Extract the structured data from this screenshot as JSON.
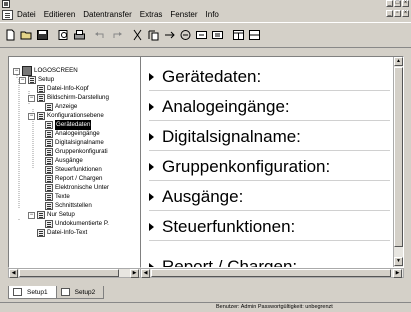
{
  "menu": {
    "items": [
      "Datei",
      "Editieren",
      "Datentransfer",
      "Extras",
      "Fenster",
      "Info"
    ]
  },
  "tree": {
    "root": "LOGOSCREEN",
    "items": [
      {
        "label": "Setup"
      },
      {
        "label": "Datei-Info-Kopf"
      },
      {
        "label": "Bildschirm-Darstellung"
      },
      {
        "label": "Anzeige"
      },
      {
        "label": "Konfigurationsebene"
      },
      {
        "label": "Gerätedaten"
      },
      {
        "label": "Analogeingänge"
      },
      {
        "label": "Digitalsignalname"
      },
      {
        "label": "Gruppenkonfigurati"
      },
      {
        "label": "Ausgänge"
      },
      {
        "label": "Steuerfunktionen"
      },
      {
        "label": "Report / Chargen"
      },
      {
        "label": "Elektronische Unter"
      },
      {
        "label": "Texte"
      },
      {
        "label": "Schnittstellen"
      },
      {
        "label": "Nur Setup"
      },
      {
        "label": "Undokumentierte P."
      },
      {
        "label": "Datei-Info-Text"
      }
    ],
    "selected_index": 5
  },
  "content": {
    "sections": [
      "Gerätedaten:",
      "Analogeingänge:",
      "Digitalsignalname:",
      "Gruppenkonfiguration:",
      "Ausgänge:",
      "Steuerfunktionen:",
      "Report / Chargen:"
    ]
  },
  "tabs": [
    "Setup1",
    "Setup2"
  ],
  "status": {
    "text": "Benutzer: Admin  Passwortgültigkeit: unbegrenzt"
  },
  "toolbar": {
    "icons": [
      "new-file-icon",
      "open-folder-icon",
      "save-icon",
      "print-preview-icon",
      "print-icon",
      "undo-icon",
      "redo-icon",
      "cut-icon",
      "copy-icon",
      "transfer-icon",
      "transfer-in-icon",
      "transfer-out-icon",
      "transfer-both-icon",
      "window-icon",
      "window-split-icon"
    ]
  }
}
